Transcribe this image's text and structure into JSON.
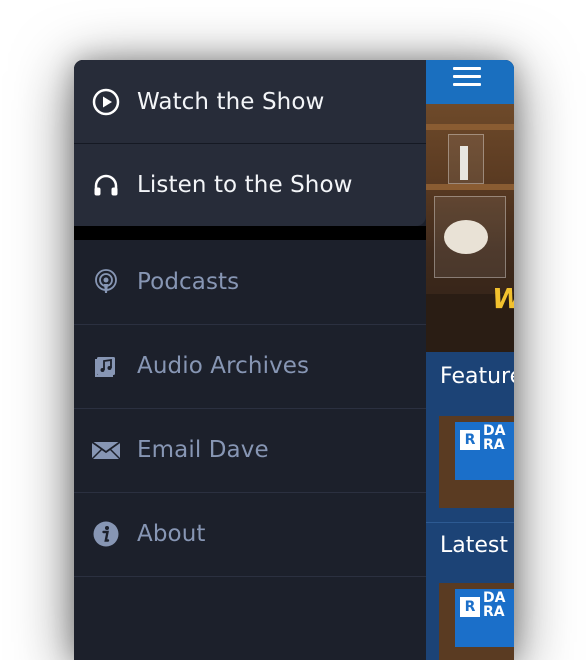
{
  "menu": {
    "primary": [
      {
        "label": "Watch the Show",
        "icon": "play-circle-icon"
      },
      {
        "label": "Listen to the Show",
        "icon": "headphones-icon"
      }
    ],
    "secondary": [
      {
        "label": "Podcasts",
        "icon": "podcast-icon"
      },
      {
        "label": "Audio Archives",
        "icon": "music-note-icon"
      },
      {
        "label": "Email Dave",
        "icon": "envelope-icon"
      },
      {
        "label": "About",
        "icon": "info-icon"
      }
    ]
  },
  "content": {
    "featured_title": "Featured",
    "latest_title": "Latest Clips",
    "thumb_logo": "R",
    "thumb_text_1": "DA",
    "thumb_text_2": "RA",
    "photo_text": "W"
  },
  "colors": {
    "menu_bg": "#1c202b",
    "menu_top_bg": "#272c39",
    "secondary_text": "#8796b4",
    "header_blue": "#1a6fbf"
  }
}
